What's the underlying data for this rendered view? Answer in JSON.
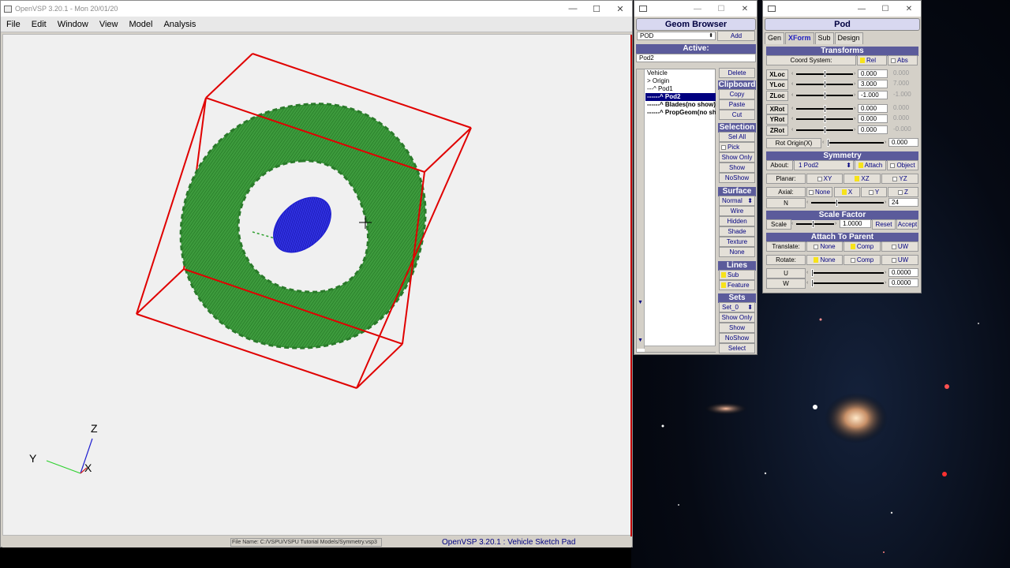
{
  "main_window": {
    "title": "OpenVSP 3.20.1 - Mon 20/01/20",
    "controls": [
      "—",
      "☐",
      "✕"
    ],
    "menu": [
      "File",
      "Edit",
      "Window",
      "View",
      "Model",
      "Analysis"
    ],
    "status_file": "File Name: C:/VSPU/VSPU Tutorial Models/Symmetry.vsp3",
    "status_app": "OpenVSP 3.20.1 : Vehicle Sketch Pad",
    "axes": {
      "x": "X",
      "y": "Y",
      "z": "Z"
    }
  },
  "geom_browser": {
    "title": "Geom Browser",
    "type_select": "POD",
    "add": "Add",
    "active_label": "Active:",
    "active_value": "Pod2",
    "tree": [
      "Vehicle",
      "> Origin",
      "---^ Pod1",
      "------^ Pod2",
      "------^ Blades(no show)",
      "------^ PropGeom(no show)"
    ],
    "selected_index": 3,
    "buttons": {
      "delete": "Delete",
      "clipboard": "Clipboard",
      "copy": "Copy",
      "paste": "Paste",
      "cut": "Cut",
      "selection": "Selection",
      "sel_all": "Sel All",
      "pick": "Pick",
      "show_only": "Show Only",
      "show": "Show",
      "noshow": "NoShow",
      "surface": "Surface",
      "surface_mode": "Normal",
      "wire": "Wire",
      "hidden": "Hidden",
      "shade": "Shade",
      "texture": "Texture",
      "none": "None",
      "lines": "Lines",
      "sub": "Sub",
      "feature": "Feature",
      "sets": "Sets",
      "set0": "Set_0",
      "sets_show_only": "Show Only",
      "sets_show": "Show",
      "sets_noshow": "NoShow",
      "select": "Select"
    }
  },
  "pod_panel": {
    "title": "Pod",
    "tabs": [
      "Gen",
      "XForm",
      "Sub",
      "Design"
    ],
    "active_tab": "XForm",
    "transforms": "Transforms",
    "coord_system": "Coord System:",
    "rel": "Rel",
    "abs": "Abs",
    "rows": [
      {
        "label": "XLoc",
        "value": "0.000",
        "abs": "0.000",
        "pos": 0.5
      },
      {
        "label": "YLoc",
        "value": "3.000",
        "abs": "7.000",
        "pos": 0.5
      },
      {
        "label": "ZLoc",
        "value": "-1.000",
        "abs": "-1.000",
        "pos": 0.5
      },
      {
        "label": "XRot",
        "value": "0.000",
        "abs": "0.000",
        "pos": 0.5
      },
      {
        "label": "YRot",
        "value": "0.000",
        "abs": "0.000",
        "pos": 0.5
      },
      {
        "label": "ZRot",
        "value": "0.000",
        "abs": "-0.000",
        "pos": 0.5
      }
    ],
    "rot_origin": {
      "label": "Rot Origin(X)",
      "value": "0.000",
      "pos": 0.0
    },
    "symmetry": "Symmetry",
    "about": "About:",
    "about_value": "1 Pod2",
    "attach": "Attach",
    "object": "Object",
    "planar": "Planar:",
    "xy": "XY",
    "xz": "XZ",
    "yz": "YZ",
    "axial": "Axial:",
    "axial_opts": [
      "None",
      "X",
      "Y",
      "Z"
    ],
    "n_label": "N",
    "n_value": "24",
    "n_pos": 0.35,
    "scale_factor": "Scale Factor",
    "scale": "Scale",
    "scale_value": "1.0000",
    "scale_pos": 0.45,
    "reset": "Reset",
    "accept": "Accept",
    "attach_parent": "Attach To Parent",
    "translate": "Translate:",
    "rotate": "Rotate:",
    "att_opts": [
      "None",
      "Comp",
      "UW"
    ],
    "u": {
      "label": "U",
      "value": "0.0000",
      "pos": 0.0
    },
    "w": {
      "label": "W",
      "value": "0.0000",
      "pos": 0.0
    }
  },
  "colors": {
    "bbox": "#e00000",
    "ring": "#2e8b2e",
    "pod": "#1a1acf",
    "accent": "#5b5b9b"
  }
}
